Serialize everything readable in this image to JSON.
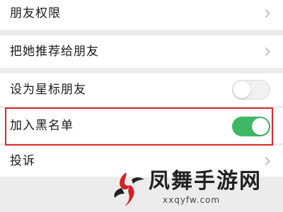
{
  "settings": {
    "items": [
      {
        "label": "朋友权限",
        "control": "chevron"
      },
      {
        "label": "把她推荐给朋友",
        "control": "chevron"
      },
      {
        "label": "设为星标朋友",
        "control": "toggle",
        "toggle_on": false
      },
      {
        "label": "加入黑名单",
        "control": "toggle",
        "toggle_on": true
      },
      {
        "label": "投诉",
        "control": "chevron"
      }
    ]
  },
  "watermark": {
    "title": "凤舞手游网",
    "subtitle": "xxqyfw.com"
  },
  "colors": {
    "toggle_on": "#3fb866",
    "highlight_border": "#e0262b",
    "page_background": "#ececec",
    "watermark_accent": "#d42027"
  },
  "icons": {
    "chevron": "chevron-right-icon",
    "logo": "phoenix-logo-icon"
  }
}
